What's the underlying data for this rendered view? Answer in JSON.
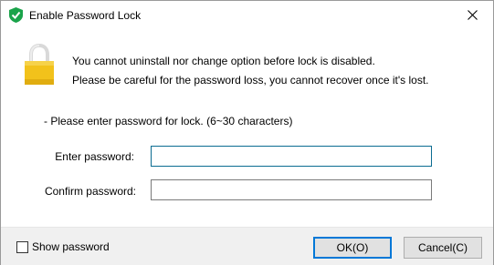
{
  "window": {
    "title": "Enable Password Lock",
    "close_icon": "close-icon",
    "app_icon": "shield-check-icon"
  },
  "message": {
    "line1": "You cannot uninstall nor change option before lock is disabled.",
    "line2": "Please be careful for the password loss, you cannot recover once it's lost.",
    "icon": "padlock-icon",
    "icon_color": "#f2c21b"
  },
  "form": {
    "instruction": "- Please enter password for lock. (6~30 characters)",
    "enter_label": "Enter password:",
    "enter_value": "",
    "confirm_label": "Confirm password:",
    "confirm_value": ""
  },
  "footer": {
    "show_password_label": "Show password",
    "show_password_checked": false,
    "ok_label": "OK(O)",
    "cancel_label": "Cancel(C)"
  },
  "colors": {
    "accent": "#0078d7",
    "brand_green": "#1aa34a",
    "focus_border": "#0b6c91"
  }
}
